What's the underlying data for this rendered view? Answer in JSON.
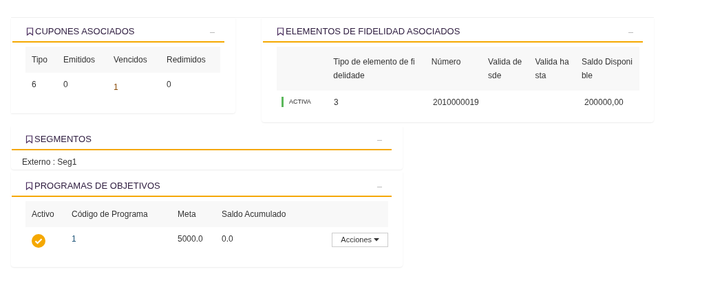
{
  "cupones": {
    "title": "CUPONES ASOCIADOS",
    "columns": [
      "Tipo",
      "Emitidos",
      "Vencidos",
      "Redimidos"
    ],
    "rows": [
      [
        {
          "text": "6",
          "link": false
        },
        {
          "text": "0",
          "link": false
        },
        {
          "text": "1",
          "link": true
        },
        {
          "text": "0",
          "link": false
        }
      ]
    ]
  },
  "fidelidad": {
    "title": "ELEMENTOS DE FIDELIDAD ASOCIADOS",
    "columns": [
      "",
      "Tipo de elemento de fidelidade",
      "Número",
      "Valida desde",
      "Valida hasta",
      "Saldo Disponible"
    ],
    "rows": [
      {
        "cells": [
          {
            "kind": "status",
            "text": "ACTIVA",
            "color": "#5cb85c"
          },
          {
            "kind": "text",
            "text": "3"
          },
          {
            "kind": "text",
            "text": "2010000019"
          },
          {
            "kind": "text",
            "text": ""
          },
          {
            "kind": "text",
            "text": ""
          },
          {
            "kind": "text",
            "text": "200000,00"
          }
        ]
      }
    ]
  },
  "segmentos": {
    "title": "SEGMENTOS",
    "text": "Externo : Seg1"
  },
  "programas": {
    "title": "PROGRAMAS DE OBJETIVOS",
    "columns": [
      "Activo",
      "Código de Programa",
      "Meta",
      "Saldo Acumulado",
      ""
    ],
    "rows": [
      {
        "active": true,
        "code": "1",
        "meta": "5000.0",
        "saldo": "0.0",
        "action": "Acciones"
      }
    ]
  }
}
